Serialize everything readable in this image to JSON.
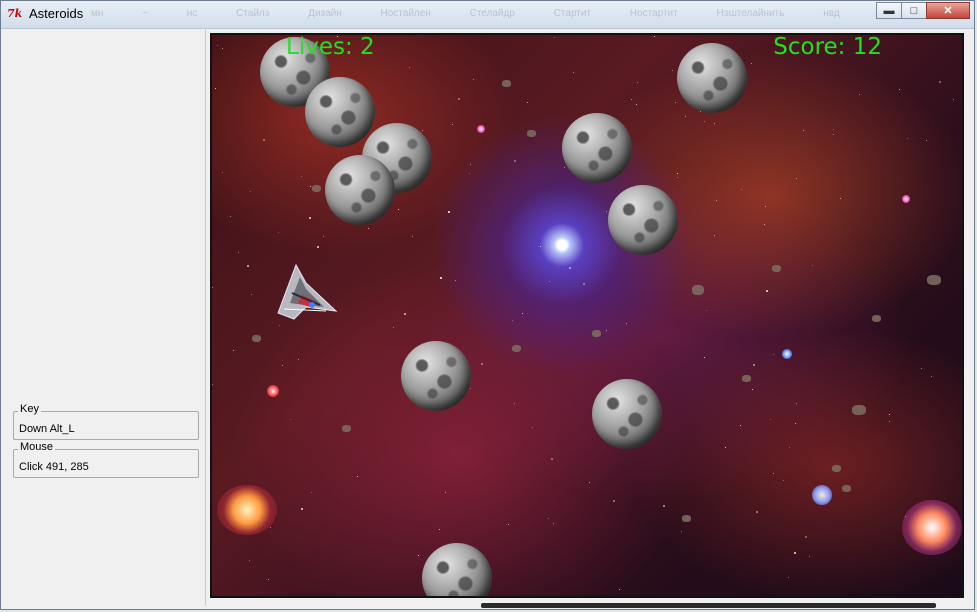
{
  "window": {
    "title": "Asteroids",
    "app_icon_text": "7k",
    "ghost_menu": "мн ~ нс Стайлз Дизайн Ностайлен Стелайдр Стартит Ностартит Нэштелайнить нвд"
  },
  "sidebar": {
    "key_group": {
      "legend": "Key",
      "value": "Down Alt_L"
    },
    "mouse_group": {
      "legend": "Mouse",
      "value": "Click 491, 285"
    }
  },
  "game": {
    "lives_text": "Lives: 2",
    "score_text": "Score: 12",
    "hud_color": "#22e022",
    "lives": 2,
    "score": 12
  },
  "icons": {
    "minimize": "minimize-icon",
    "maximize": "maximize-icon",
    "close": "close-icon"
  }
}
